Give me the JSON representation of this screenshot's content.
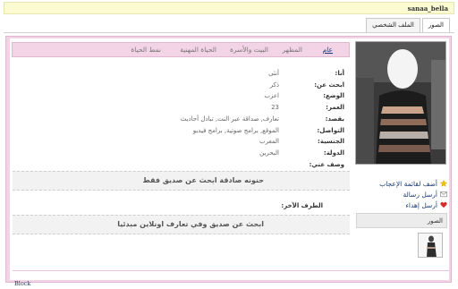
{
  "username": "sanaa_bella",
  "tabs": [
    {
      "label": "الملف الشخصي"
    },
    {
      "label": "الصور"
    }
  ],
  "subnav": [
    {
      "label": "عام"
    },
    {
      "label": "المظهر"
    },
    {
      "label": "البيت والأسرة"
    },
    {
      "label": "الحياة المهنية"
    },
    {
      "label": "نمط الحياة"
    }
  ],
  "profile": {
    "fields": [
      {
        "label": "أنا:",
        "value": "أنثى"
      },
      {
        "label": "ابحث عن:",
        "value": "ذكر"
      },
      {
        "label": "الوضع:",
        "value": "اعزب"
      },
      {
        "label": "العمر:",
        "value": "23"
      },
      {
        "label": "بقصد:",
        "value": "تعارف, صداقة عبر النت, تبادل أحاديث"
      },
      {
        "label": "التواصل:",
        "value": "الموقع, برامج صوتية, برامج فيديو"
      },
      {
        "label": "الجنسية:",
        "value": "المغرب"
      },
      {
        "label": "الدولة:",
        "value": "البحرين"
      },
      {
        "label": "وصف عني:",
        "value": ""
      }
    ],
    "about_text": "حنونه صادقة ابحث عن صديق فقط",
    "partner_label": "الطرف الآخر:",
    "partner_text": "ابحث عن صديق وفي تعارف اونلاين مبدئيا"
  },
  "actions": [
    {
      "label": "أضف لقائمة الإعجاب",
      "icon": "star-icon"
    },
    {
      "label": "أرسل رسالة",
      "icon": "envelope-icon"
    },
    {
      "label": "أرسل إهداء",
      "icon": "heart-icon"
    }
  ],
  "photos_section": {
    "title": "الصور"
  },
  "footer": {
    "link": "Block"
  },
  "colors": {
    "frame": "#f3d3e6",
    "link": "#1b3a75",
    "header": "#fbfbd2"
  }
}
